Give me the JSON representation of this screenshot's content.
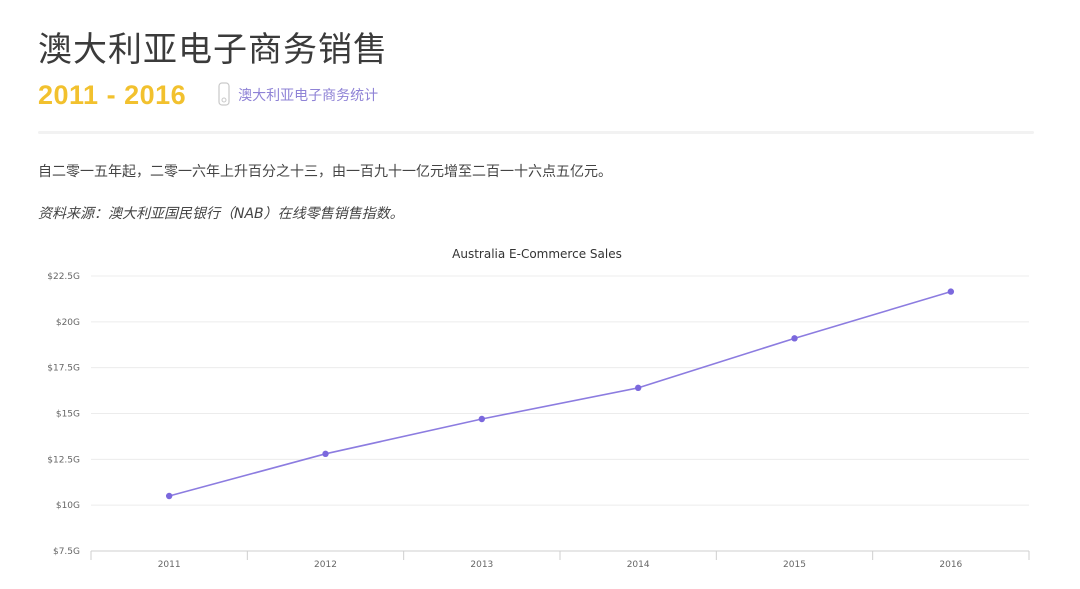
{
  "header": {
    "title": "澳大利亚电子商务销售",
    "years": "2011 - 2016",
    "tag_icon": "usb-drive-icon",
    "tag_label": "澳大利亚电子商务统计"
  },
  "body": {
    "paragraph": "自二零一五年起，二零一六年上升百分之十三，由一百九十一亿元增至二百一十六点五亿元。",
    "source": "资料来源：澳大利亚国民银行（NAB）在线零售销售指数。"
  },
  "colors": {
    "title": "#3b3b3b",
    "years": "#f2c12e",
    "accent": "#8f83d6",
    "line": "#8c7ce0",
    "point": "#7b68dd"
  },
  "chart_data": {
    "type": "line",
    "title": "Australia E-Commerce Sales",
    "categories": [
      "2011",
      "2012",
      "2013",
      "2014",
      "2015",
      "2016"
    ],
    "values": [
      10.5,
      12.8,
      14.7,
      16.4,
      19.1,
      21.65
    ],
    "ylim": [
      7.5,
      22.5
    ],
    "yticks": [
      7.5,
      10,
      12.5,
      15,
      17.5,
      20,
      22.5
    ],
    "ytick_labels": [
      "$7.5G",
      "$10G",
      "$12.5G",
      "$15G",
      "$17.5G",
      "$20G",
      "$22.5G"
    ],
    "grid": true,
    "legend": false
  }
}
